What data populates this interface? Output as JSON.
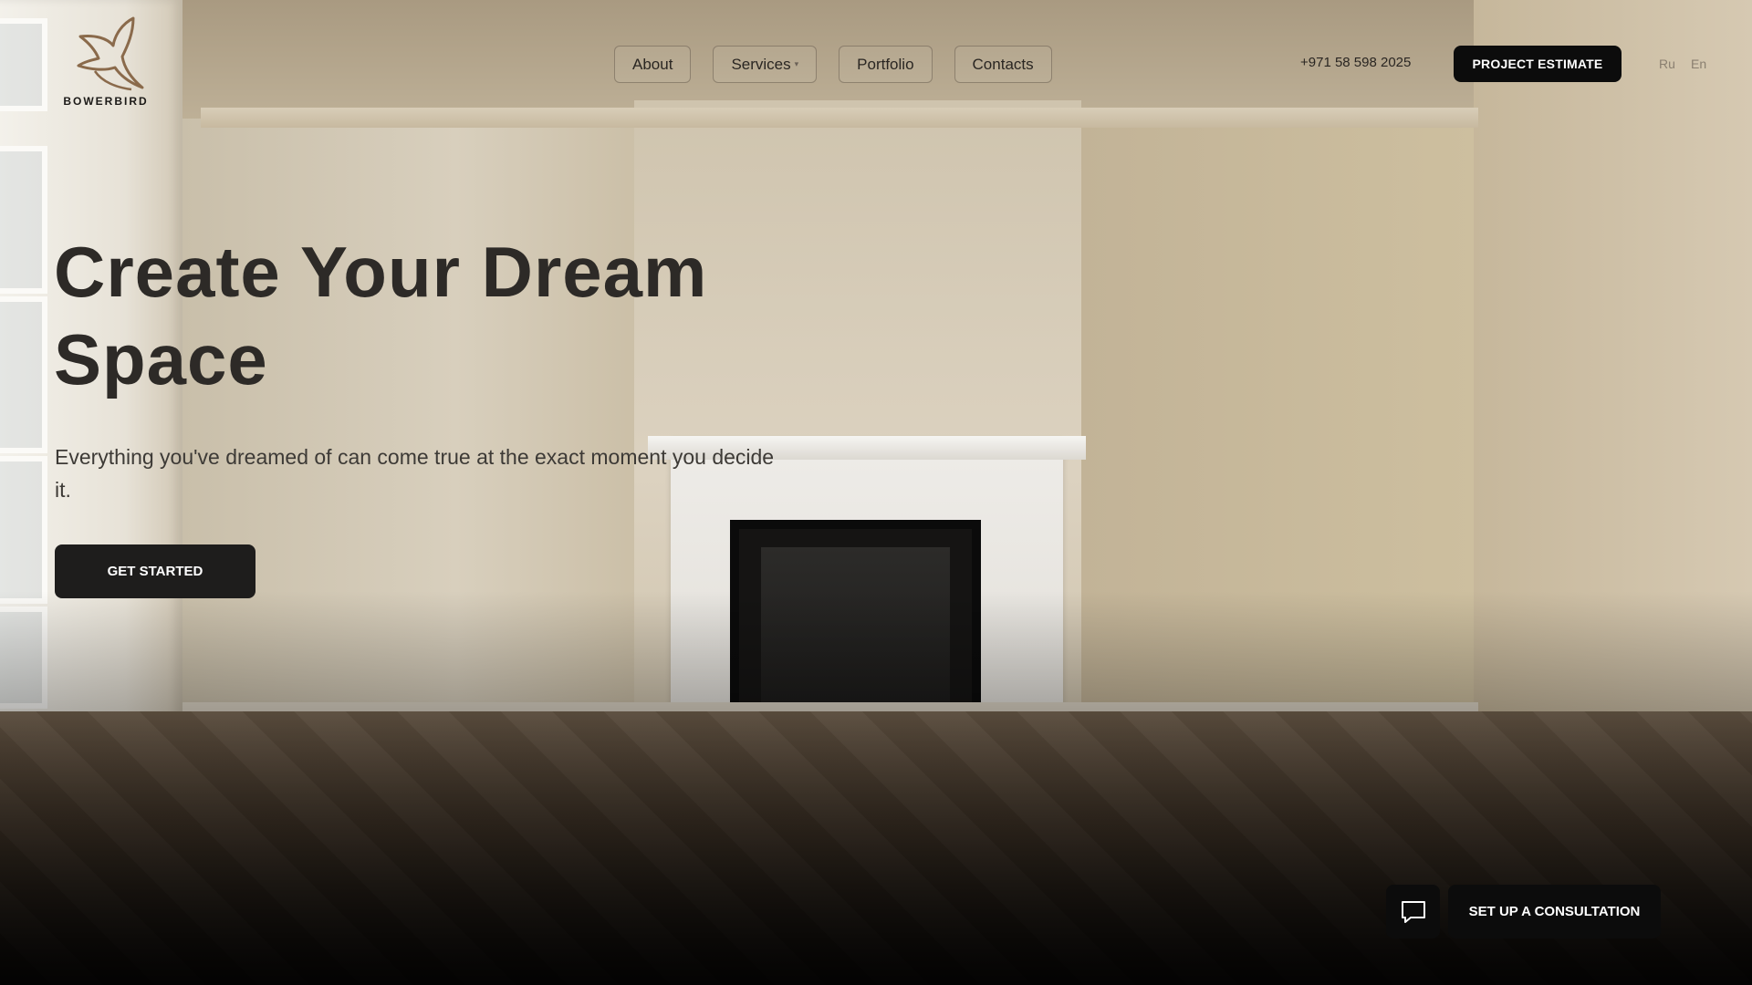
{
  "brand": {
    "name": "BOWERBIRD",
    "logo_icon": "bird-logo-icon"
  },
  "nav": {
    "items": [
      {
        "label": "About"
      },
      {
        "label": "Services",
        "has_dropdown": true
      },
      {
        "label": "Portfolio"
      },
      {
        "label": "Contacts"
      }
    ]
  },
  "header": {
    "phone": "+971 58 598 2025",
    "estimate_label": "PROJECT ESTIMATE",
    "languages": [
      "Ru",
      "En"
    ]
  },
  "hero": {
    "title": "Create Your Dream Space",
    "subtitle": "Everything you've dreamed of can come true at the exact moment you decide it.",
    "cta_label": "GET STARTED"
  },
  "consult": {
    "chat_icon": "chat-bubble-icon",
    "label": "SET UP A CONSULTATION"
  },
  "colors": {
    "primary_button": "#0c0c0c",
    "text_dark": "#2d2a27"
  }
}
